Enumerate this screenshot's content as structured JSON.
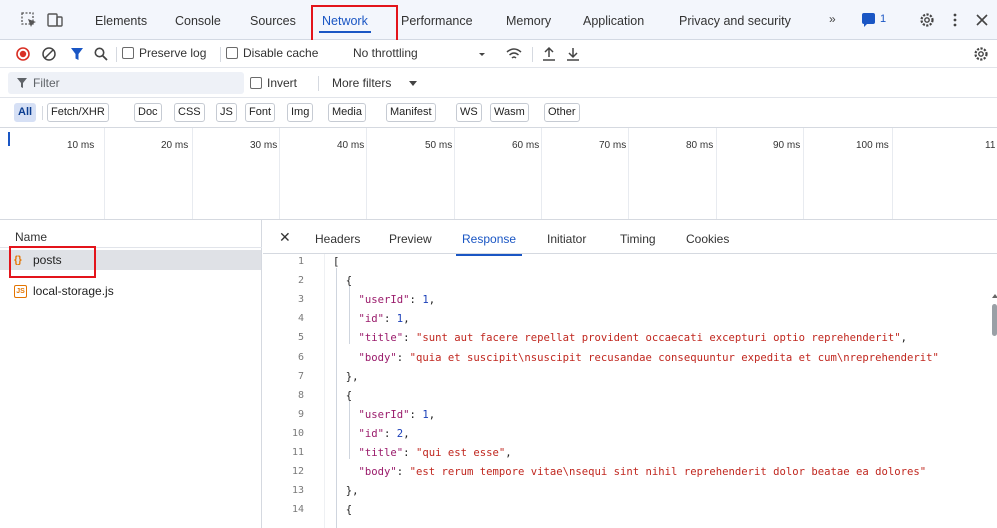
{
  "tabs": {
    "items": [
      {
        "label": "Elements"
      },
      {
        "label": "Console"
      },
      {
        "label": "Sources"
      },
      {
        "label": "Network",
        "active": true
      },
      {
        "label": "Performance"
      },
      {
        "label": "Memory"
      },
      {
        "label": "Application"
      },
      {
        "label": "Privacy and security"
      }
    ],
    "more_label": "»",
    "issues_count": "1",
    "accent_color": "#1a56c4",
    "highlight_color": "#e3141b"
  },
  "toolbar": {
    "preserve_log_label": "Preserve log",
    "disable_cache_label": "Disable cache",
    "throttling_value": "No throttling"
  },
  "filter": {
    "placeholder": "Filter",
    "invert_label": "Invert",
    "more_filters_label": "More filters"
  },
  "types": [
    "All",
    "Fetch/XHR",
    "Doc",
    "CSS",
    "JS",
    "Font",
    "Img",
    "Media",
    "Manifest",
    "WS",
    "Wasm",
    "Other"
  ],
  "timeline": {
    "ticks": [
      "10 ms",
      "20 ms",
      "30 ms",
      "40 ms",
      "50 ms",
      "60 ms",
      "70 ms",
      "80 ms",
      "90 ms",
      "100 ms",
      "11"
    ]
  },
  "requests": {
    "header": "Name",
    "items": [
      {
        "name": "posts",
        "icon": "fetch-icon",
        "selected": true
      },
      {
        "name": "local-storage.js",
        "icon": "script-icon",
        "selected": false
      }
    ]
  },
  "details": {
    "tabs": [
      "Headers",
      "Preview",
      "Response",
      "Initiator",
      "Timing",
      "Cookies"
    ],
    "active_tab": "Response"
  },
  "response": {
    "lines": [
      "[",
      "  {",
      "    \"userId\": 1,",
      "    \"id\": 1,",
      "    \"title\": \"sunt aut facere repellat provident occaecati excepturi optio reprehenderit\",",
      "    \"body\": \"quia et suscipit\\nsuscipit recusandae consequuntur expedita et cum\\nreprehenderit\"",
      "  },",
      "  {",
      "    \"userId\": 1,",
      "    \"id\": 2,",
      "    \"title\": \"qui est esse\",",
      "    \"body\": \"est rerum tempore vitae\\nsequi sint nihil reprehenderit dolor beatae ea dolores\"",
      "  },",
      "  {"
    ]
  }
}
